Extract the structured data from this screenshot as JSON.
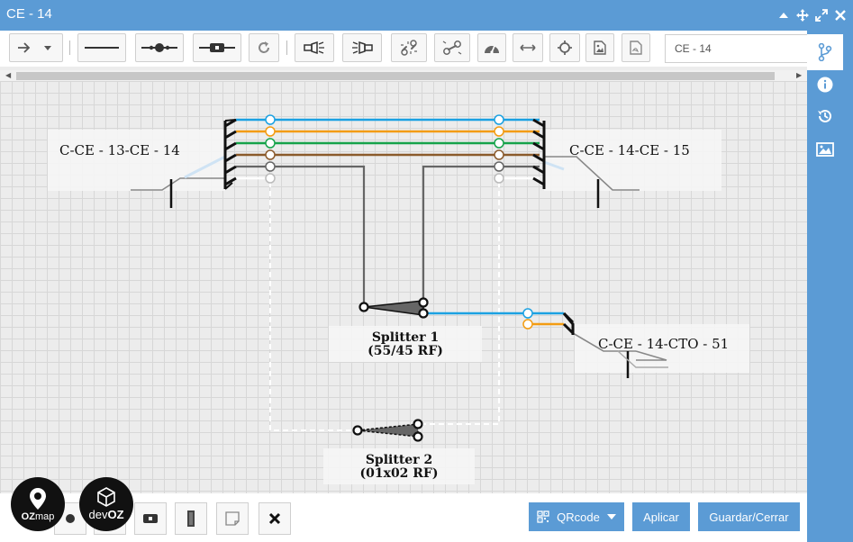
{
  "window": {
    "title": "CE - 14"
  },
  "toolbar": {
    "name_value": "CE - 14"
  },
  "labels": {
    "left_cable": "C-CE - 13-CE - 14",
    "right_cable": "C-CE - 14-CE - 15",
    "cto_cable": "C-CE - 14-CTO - 51",
    "splitter1_name": "Splitter 1",
    "splitter1_ratio": "(55/45 RF)",
    "splitter2_name": "Splitter 2",
    "splitter2_ratio": "(01x02 RF)"
  },
  "bottom": {
    "qrcode_label": "QRcode",
    "apply_label": "Aplicar",
    "save_close_label": "Guardar/Cerrar"
  },
  "logos": {
    "ozmap_main": "OZ",
    "ozmap_sub": "map",
    "devoz_main": "dev",
    "devoz_sub": "OZ"
  },
  "colors": {
    "accent": "#5b9bd5",
    "fiber_blue": "#1ba1e2",
    "fiber_orange": "#f39c12",
    "fiber_green": "#16a34a",
    "fiber_brown": "#8b5a2b",
    "fiber_gray": "#555555",
    "fiber_white": "#ffffff"
  },
  "icons": {
    "toolbar": [
      "arrow-right-icon",
      "chevron-down-icon",
      "line-icon",
      "fusion-icon",
      "connector-icon",
      "rotate-icon",
      "flashlight-icon",
      "flashlight-reverse-icon",
      "unlink-icon",
      "link-icon",
      "gauge-icon",
      "horizontal-arrows-icon",
      "crosshair-icon",
      "image-export-icon",
      "pdf-icon"
    ],
    "sidebar": [
      "branch-icon",
      "info-icon",
      "history-icon",
      "image-icon"
    ]
  }
}
